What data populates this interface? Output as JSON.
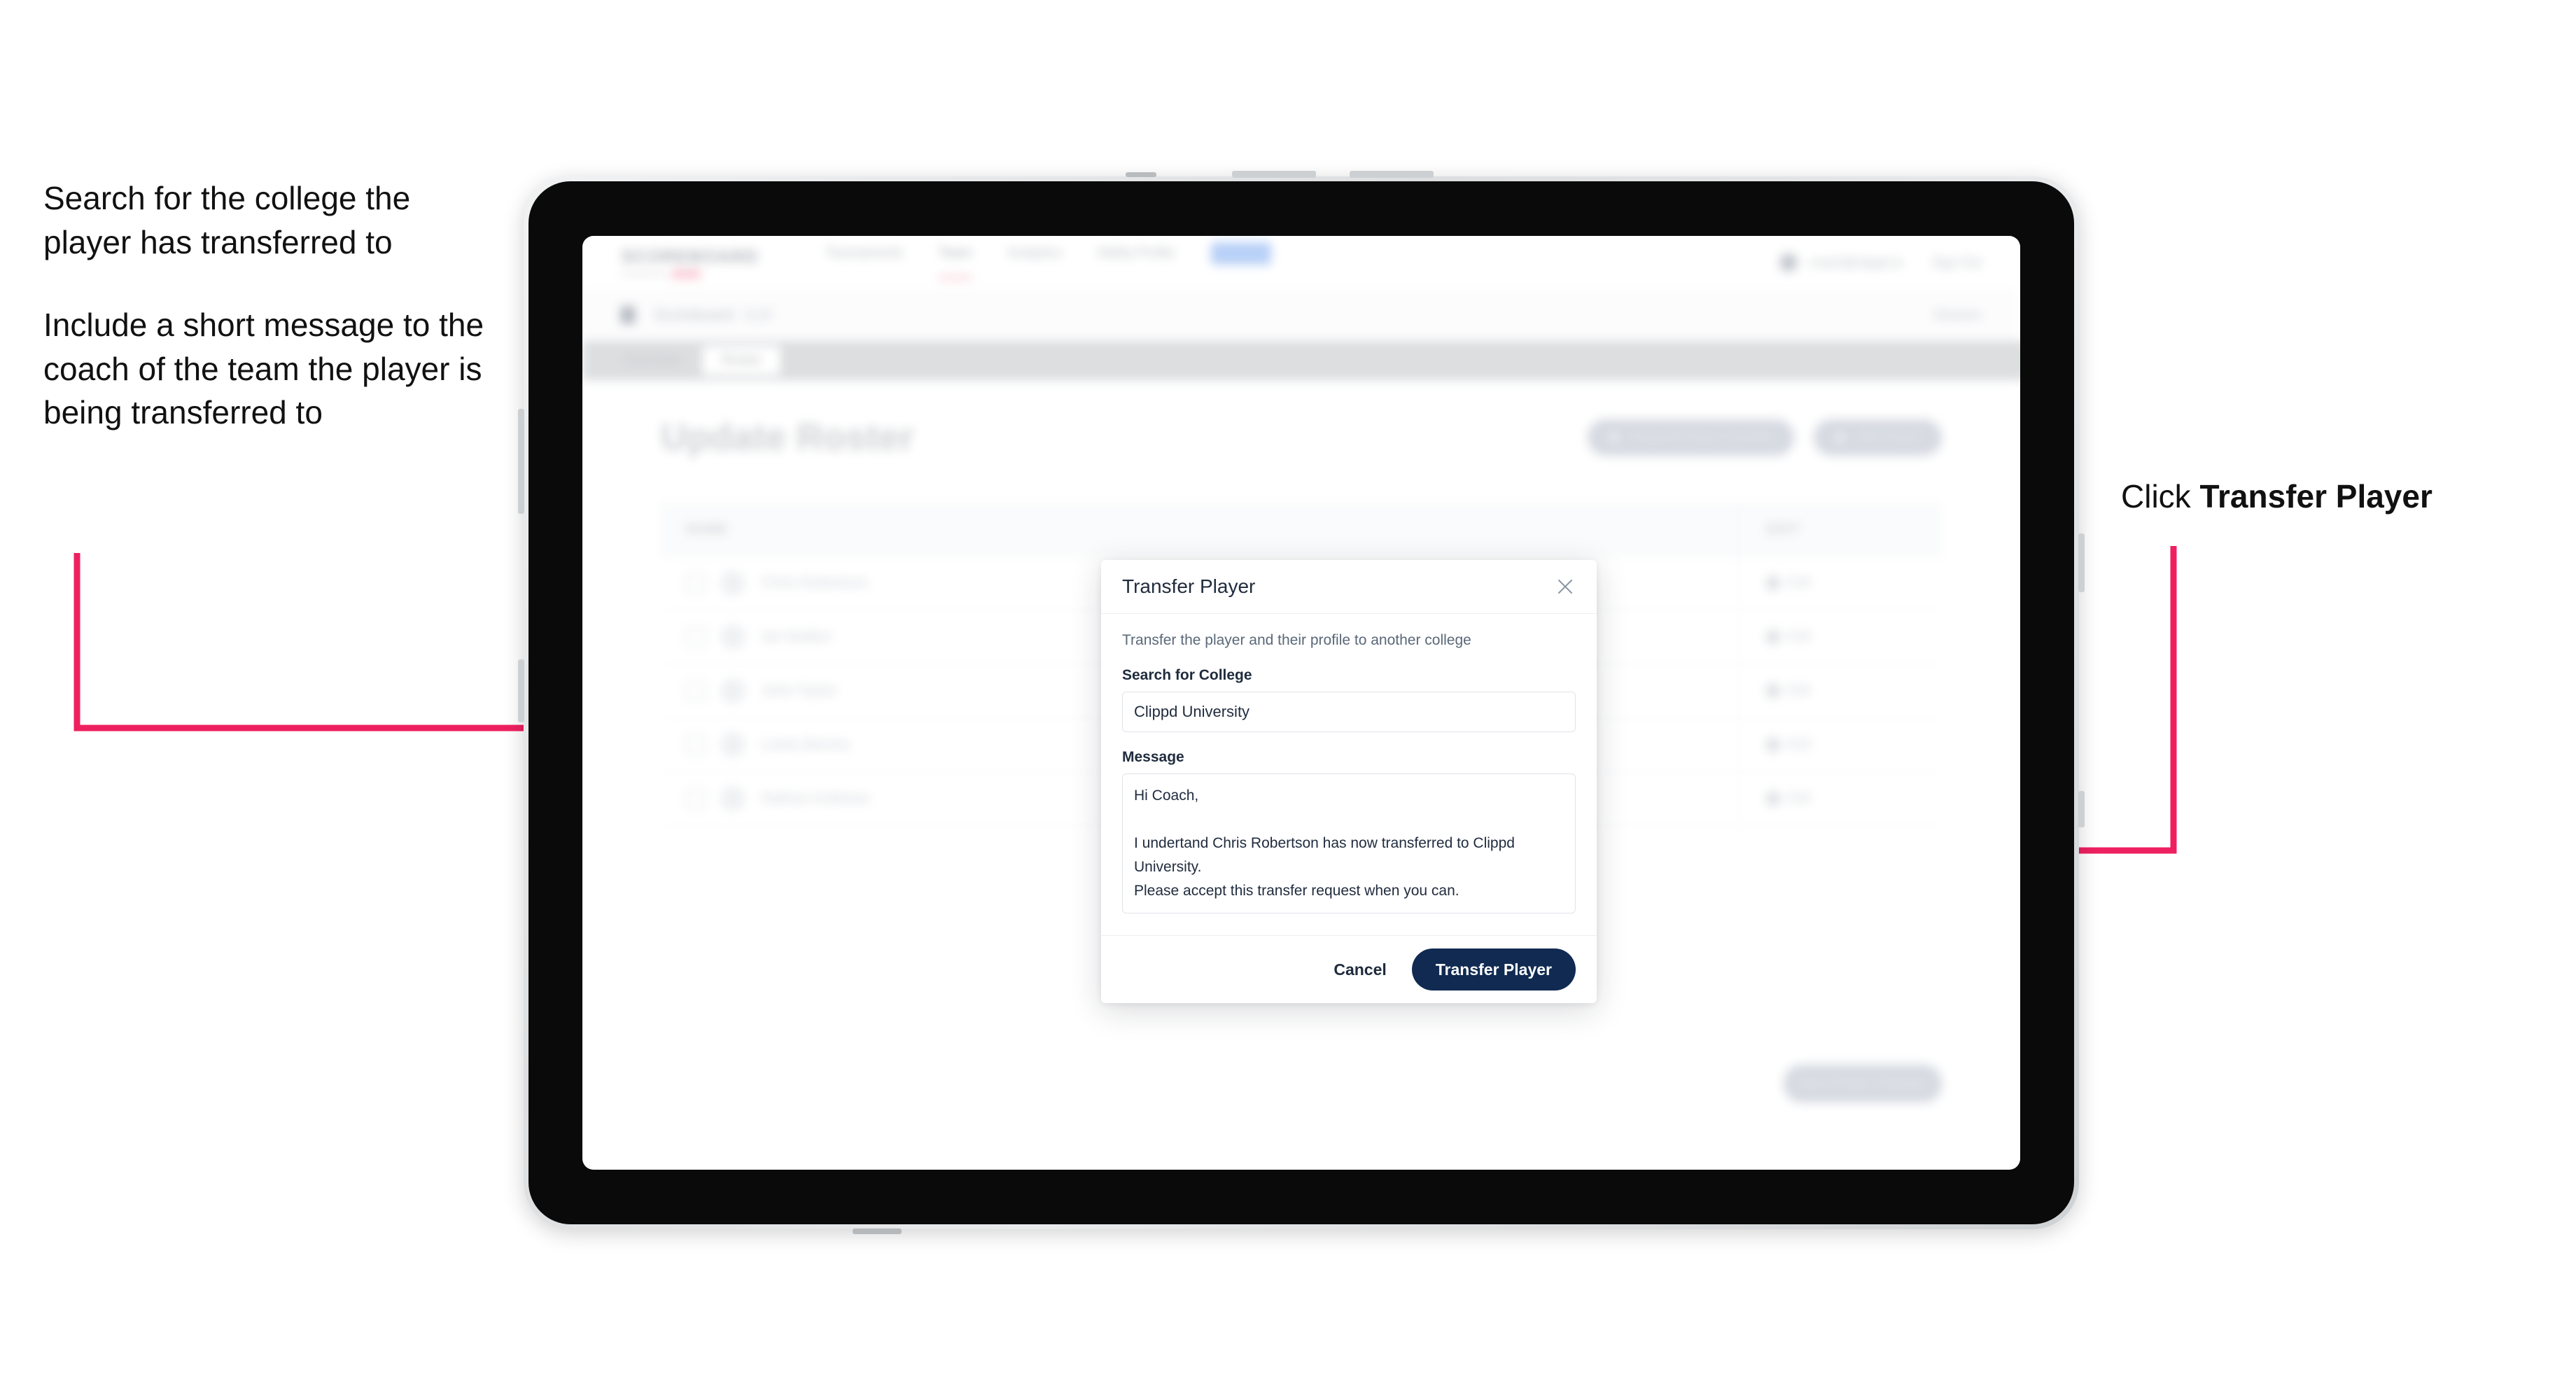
{
  "annotations": {
    "left": [
      "Search for the college the player has transferred to",
      "Include a short message to the coach of the team the player is being transferred to"
    ],
    "right_prefix": "Click ",
    "right_strong": "Transfer Player"
  },
  "colors": {
    "arrow": "#ee2060",
    "primary_button": "#102a51",
    "text_dark": "#1f2b3d"
  },
  "app": {
    "brand": {
      "word": "SCOREBOARD",
      "sub": "Powered by",
      "badge": "clippd"
    },
    "nav_items": [
      {
        "label": "Tournaments"
      },
      {
        "label": "Team"
      },
      {
        "label": "Analytics"
      },
      {
        "label": "Ability Profile"
      },
      {
        "label": "Admin"
      }
    ],
    "user": {
      "email": "coach@clippd.io",
      "sign_out": "Sign Out"
    },
    "subheader": {
      "title": "Scoreboard",
      "muted": "Golf",
      "right": "Season"
    },
    "tabs": [
      {
        "label": "Overview",
        "active": false
      },
      {
        "label": "Roster",
        "active": true
      }
    ],
    "page_title": "Update Roster",
    "header_buttons": [
      {
        "label": "Request Player Transfer"
      },
      {
        "label": "Add Player"
      }
    ],
    "table": {
      "columns": [
        "NAME",
        "EDIT"
      ],
      "rows": [
        {
          "name": "Chris Robertson",
          "edit": "Edit"
        },
        {
          "name": "Ian Walker",
          "edit": "Edit"
        },
        {
          "name": "John Taylor",
          "edit": "Edit"
        },
        {
          "name": "Lewis Barnes",
          "edit": "Edit"
        },
        {
          "name": "Nathan Andrews",
          "edit": "Edit"
        }
      ]
    },
    "footer_button": "Save Roster Changes"
  },
  "modal": {
    "title": "Transfer Player",
    "description": "Transfer the player and their profile to another college",
    "college_label": "Search for College",
    "college_value": "Clippd University",
    "college_placeholder": "Search for College",
    "message_label": "Message",
    "message_value": "Hi Coach,\n\nI undertand Chris Robertson has now transferred to Clippd University.\nPlease accept this transfer request when you can.",
    "message_placeholder": "Message",
    "cancel_label": "Cancel",
    "submit_label": "Transfer Player"
  }
}
